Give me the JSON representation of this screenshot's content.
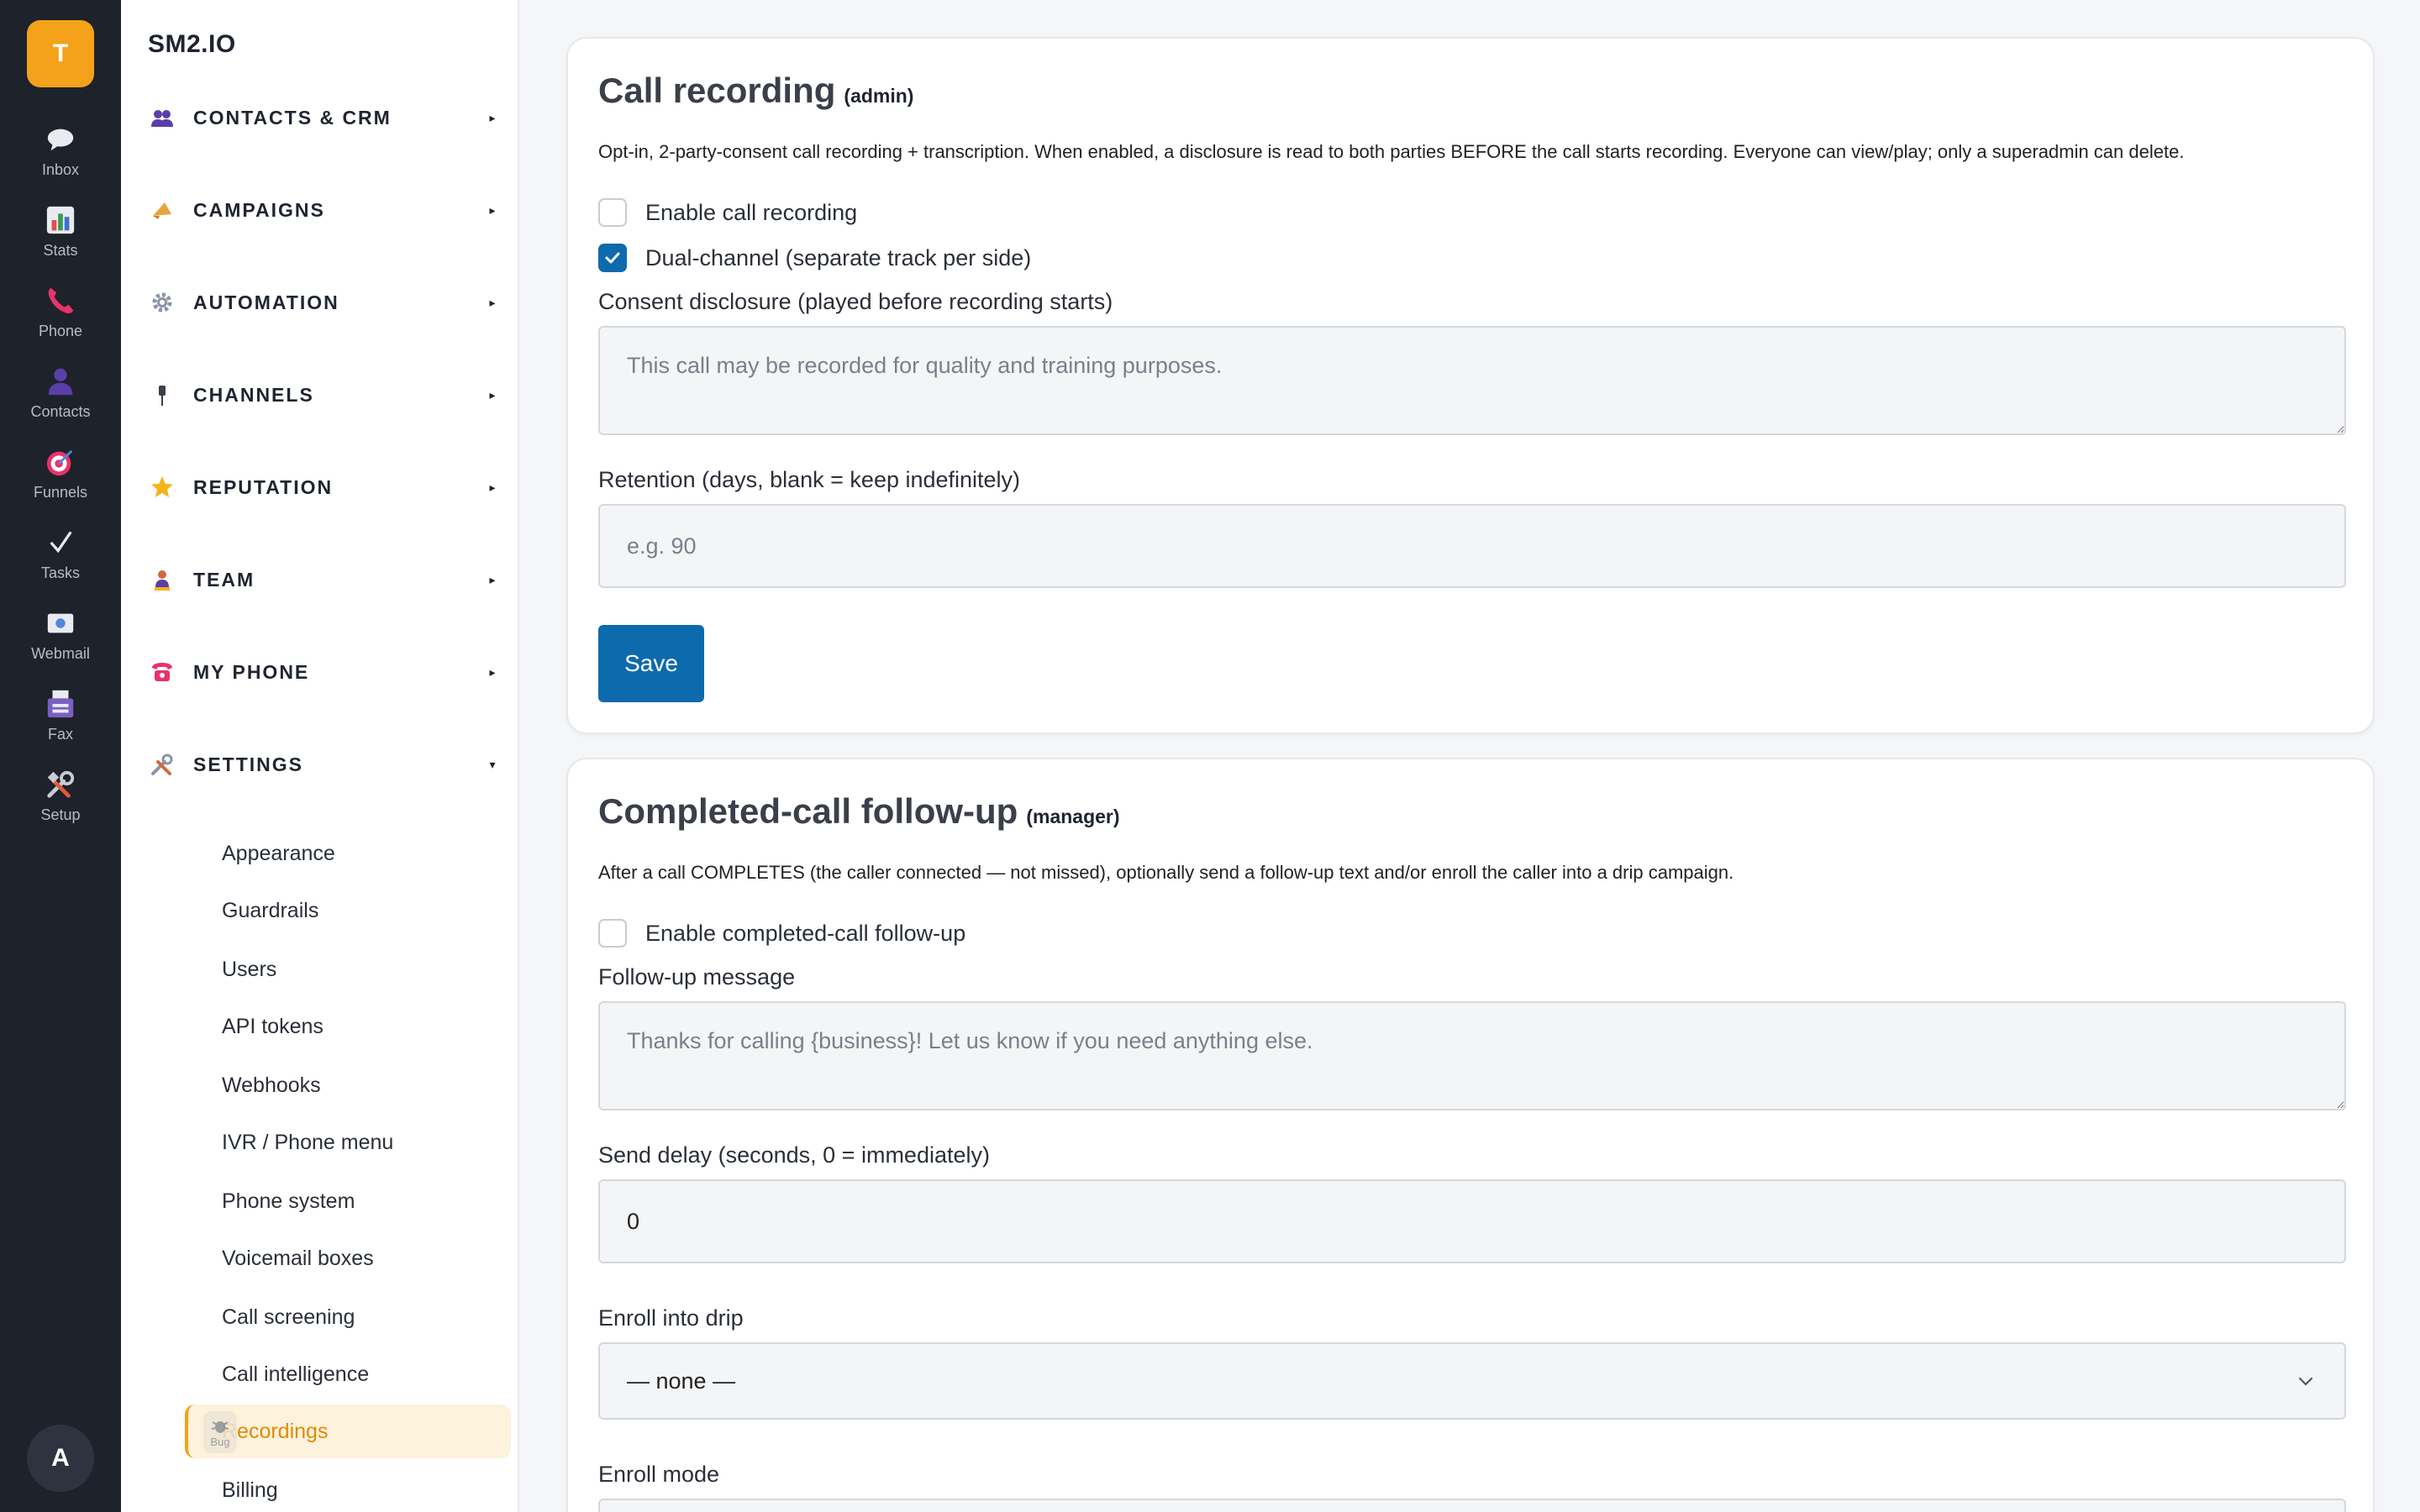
{
  "rail": {
    "logo_letter": "T",
    "items": [
      {
        "label": "Inbox",
        "icon": "speech-bubble-icon"
      },
      {
        "label": "Stats",
        "icon": "bar-chart-icon"
      },
      {
        "label": "Phone",
        "icon": "phone-icon"
      },
      {
        "label": "Contacts",
        "icon": "person-icon"
      },
      {
        "label": "Funnels",
        "icon": "target-icon"
      },
      {
        "label": "Tasks",
        "icon": "checkmark-icon"
      },
      {
        "label": "Webmail",
        "icon": "mail-icon"
      },
      {
        "label": "Fax",
        "icon": "fax-icon"
      },
      {
        "label": "Setup",
        "icon": "tools-icon"
      }
    ],
    "avatar_letter": "A"
  },
  "sidebar": {
    "brand": "SM2.IO",
    "groups": [
      {
        "label": "CONTACTS & CRM",
        "icon": "people-icon",
        "caret": "▸"
      },
      {
        "label": "CAMPAIGNS",
        "icon": "megaphone-icon",
        "caret": "▸"
      },
      {
        "label": "AUTOMATION",
        "icon": "gear-icon",
        "caret": "▸"
      },
      {
        "label": "CHANNELS",
        "icon": "plug-icon",
        "caret": "▸"
      },
      {
        "label": "REPUTATION",
        "icon": "star-icon",
        "caret": "▸"
      },
      {
        "label": "TEAM",
        "icon": "trophy-person-icon",
        "caret": "▸"
      },
      {
        "label": "MY PHONE",
        "icon": "telephone-icon",
        "caret": "▸"
      },
      {
        "label": "SETTINGS",
        "icon": "tools-icon",
        "caret": "▾"
      }
    ],
    "settings_items": [
      "Appearance",
      "Guardrails",
      "Users",
      "API tokens",
      "Webhooks",
      "IVR / Phone menu",
      "Phone system",
      "Voicemail boxes",
      "Call screening",
      "Call intelligence",
      "Recordings",
      "Billing"
    ],
    "active_item": "Recordings",
    "bug_badge": "Bug"
  },
  "call_recording": {
    "title": "Call recording",
    "role": "(admin)",
    "description": "Opt-in, 2-party-consent call recording + transcription. When enabled, a disclosure is read to both parties BEFORE the call starts recording. Everyone can view/play; only a superadmin can delete.",
    "enable_label": "Enable call recording",
    "enable_checked": false,
    "dual_label": "Dual-channel (separate track per side)",
    "dual_checked": true,
    "consent_label": "Consent disclosure (played before recording starts)",
    "consent_placeholder": "This call may be recorded for quality and training purposes.",
    "retention_label": "Retention (days, blank = keep indefinitely)",
    "retention_placeholder": "e.g. 90",
    "save_label": "Save"
  },
  "followup": {
    "title": "Completed-call follow-up",
    "role": "(manager)",
    "description": "After a call COMPLETES (the caller connected — not missed), optionally send a follow-up text and/or enroll the caller into a drip campaign.",
    "enable_label": "Enable completed-call follow-up",
    "enable_checked": false,
    "message_label": "Follow-up message",
    "message_placeholder": "Thanks for calling {business}! Let us know if you need anything else.",
    "delay_label": "Send delay (seconds, 0 = immediately)",
    "delay_value": "0",
    "drip_label": "Enroll into drip",
    "drip_value": "— none —",
    "mode_label": "Enroll mode"
  },
  "colors": {
    "rail_bg": "#1d222b",
    "accent_orange": "#f4a21a",
    "primary_blue": "#0d6aad",
    "active_bg": "#fdf2dc"
  }
}
